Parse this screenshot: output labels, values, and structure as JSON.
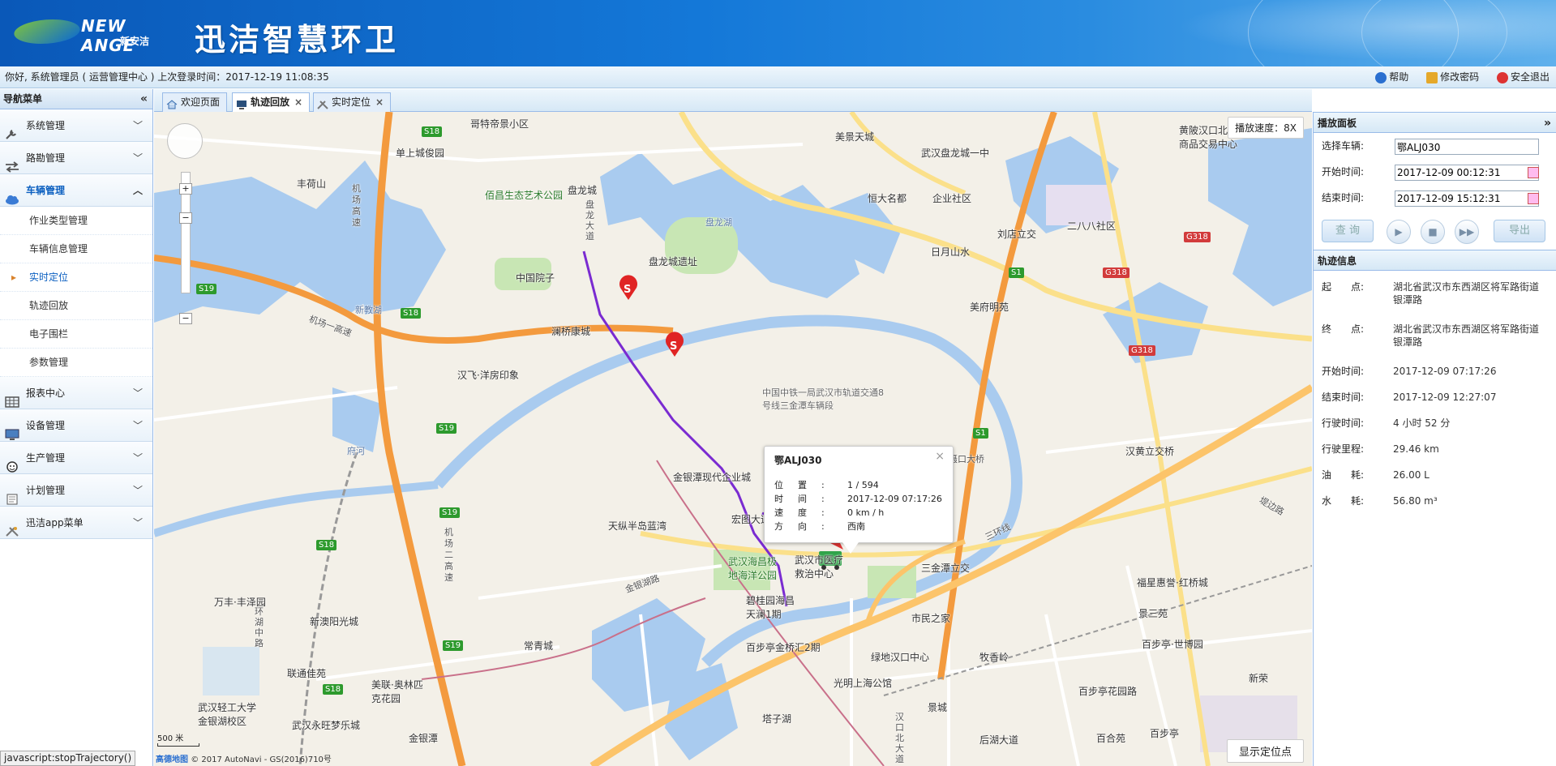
{
  "header": {
    "brand_en": "NEW ANGE",
    "brand_cn": "新安洁",
    "title": "迅洁智慧环卫"
  },
  "userbar": {
    "greeting": "你好, 系统管理员 ( 运营管理中心 ) 上次登录时间：2017-12-19 11:08:35",
    "help": "帮助",
    "change_password": "修改密码",
    "logout": "安全退出"
  },
  "sidebar": {
    "title": "导航菜单",
    "collapse": "«",
    "menus": [
      {
        "label": "系统管理",
        "icon": "wrench-icon"
      },
      {
        "label": "路勘管理",
        "icon": "arrows-icon"
      },
      {
        "label": "车辆管理",
        "icon": "cloud-icon",
        "active": true
      }
    ],
    "submenu": [
      {
        "label": "作业类型管理"
      },
      {
        "label": "车辆信息管理"
      },
      {
        "label": "实时定位",
        "active": true
      },
      {
        "label": "轨迹回放"
      },
      {
        "label": "电子围栏"
      },
      {
        "label": "参数管理"
      }
    ],
    "menus2": [
      {
        "label": "报表中心",
        "icon": "grid-icon"
      },
      {
        "label": "设备管理",
        "icon": "monitor-icon"
      },
      {
        "label": "生产管理",
        "icon": "smiley-icon"
      },
      {
        "label": "计划管理",
        "icon": "document-icon"
      },
      {
        "label": "迅洁app菜单",
        "icon": "tools-icon"
      }
    ]
  },
  "tabs": [
    {
      "label": "欢迎页面",
      "closable": false
    },
    {
      "label": "轨迹回放",
      "closable": true,
      "active": true
    },
    {
      "label": "实时定位",
      "closable": true
    }
  ],
  "map": {
    "speed_label": "播放速度：8X",
    "locate_button": "显示定位点",
    "scale": "500 米",
    "copyright": "© 2017 AutoNavi - GS(2016)710号",
    "amap": "高德地图",
    "labels": {
      "l1": "哥特帝景小区",
      "l2": "单上城俊园",
      "l3": "丰荷山",
      "l4": "佰昌生态艺术公园",
      "l5": "盘龙城",
      "l6": "盘龙城遗址",
      "l7": "中国院子",
      "l8": "澜桥康城",
      "l9": "汉飞·洋房印象",
      "l10": "美景天城",
      "l11": "武汉盘龙城一中",
      "l12": "恒大名都",
      "l13": "企业社区",
      "l14": "刘店立交",
      "l15": "二八八社区",
      "l16": "日月山水",
      "l17": "美府明苑",
      "l18": "黄陂汉口北国际商品交易中心",
      "l19": "中国中铁一局武汉市轨道交通8号线三金潭车辆段",
      "l20": "金银潭现代企业城",
      "l21": "天纵半岛蓝湾",
      "l22": "宏图大道",
      "l23": "武汉海昌极地海洋公园",
      "l24": "武汉市医疗救治中心",
      "l25": "碧桂园海昌天澜1期",
      "l26": "三金潭立交",
      "l27": "汉黄立交桥",
      "l28": "福星惠誉·红桥城",
      "l29": "景三苑",
      "l30": "百步亭·世博园",
      "l31": "牧香岭",
      "l32": "绿地汉口中心",
      "l33": "市民之家",
      "l34": "百步亭金桥汇2期",
      "l35": "光明上海公馆",
      "l36": "景城",
      "l37": "后湖大道",
      "l38": "百合苑",
      "l39": "百步亭",
      "l40": "百步亭花园路",
      "l41": "新荣",
      "l42": "万丰·丰泽园",
      "l43": "新澳阳光城",
      "l44": "联通佳苑",
      "l45": "美联·奥林匹克花园",
      "l46": "武汉轻工大学金银湖校区",
      "l47": "武汉永旺梦乐城",
      "l48": "金银潭",
      "l49": "常青城",
      "l50": "塔子湖",
      "l51": "新教湖",
      "l52": "机场高速",
      "l53": "府河",
      "l54": "三环线",
      "l55": "盘龙湖",
      "l56": "机场一高速",
      "l57": "堤边路",
      "l58": "滠口大桥",
      "l59": "盘龙大道",
      "l60": "环湖中路",
      "l61": "机场二高速",
      "l62": "金银湖路",
      "l63": "汉口北大道"
    },
    "shields": {
      "s1": "S18",
      "s2": "S19",
      "s3": "S18",
      "s4": "S19",
      "s5": "S19",
      "s6": "S18",
      "s7": "S19",
      "s8": "S18",
      "s9": "S1",
      "s10": "S1",
      "g1": "G318",
      "g2": "G318",
      "g3": "G318"
    }
  },
  "popup": {
    "title": "鄂ALJ030",
    "rows": [
      {
        "k": "位置:",
        "v": "1 / 594"
      },
      {
        "k": "时间:",
        "v": "2017-12-09 07:17:26"
      },
      {
        "k": "速度:",
        "v": "0 km / h"
      },
      {
        "k": "方向:",
        "v": "西南"
      }
    ]
  },
  "play_panel": {
    "title": "播放面板",
    "vehicle_label": "选择车辆:",
    "vehicle_value": "鄂ALJ030",
    "start_label": "开始时间:",
    "start_value": "2017-12-09 00:12:31",
    "end_label": "结束时间:",
    "end_value": "2017-12-09 15:12:31",
    "query": "查 询",
    "export": "导出"
  },
  "track_info": {
    "title": "轨迹信息",
    "rows": [
      {
        "k": "起　　点:",
        "v": "湖北省武汉市东西湖区将军路街道银潭路"
      },
      {
        "k": "终　　点:",
        "v": "湖北省武汉市东西湖区将军路街道银潭路"
      },
      {
        "k": "开始时间:",
        "v": "2017-12-09 07:17:26"
      },
      {
        "k": "结束时间:",
        "v": "2017-12-09 12:27:07"
      },
      {
        "k": "行驶时间:",
        "v": "4 小时 52 分"
      },
      {
        "k": "行驶里程:",
        "v": "29.46 km"
      },
      {
        "k": "油　　耗:",
        "v": "26.00 L"
      },
      {
        "k": "水　　耗:",
        "v": "56.80 m³"
      }
    ]
  },
  "statusbar": "javascript:stopTrajectory()",
  "colors": {
    "header": "#1478d8",
    "accent": "#0b5fc0",
    "track": "#7a2bd1",
    "highway": "#f39a3e"
  }
}
